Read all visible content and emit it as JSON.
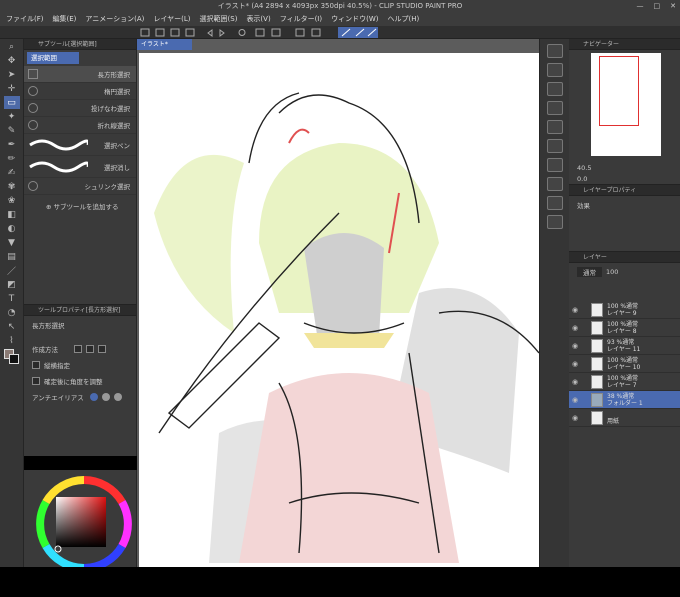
{
  "window": {
    "title": "イラスト* (A4 2894 x 4093px 350dpi 40.5%) - CLIP STUDIO PAINT PRO"
  },
  "menu": [
    "ファイル(F)",
    "編集(E)",
    "アニメーション(A)",
    "レイヤー(L)",
    "選択範囲(S)",
    "表示(V)",
    "フィルター(I)",
    "ウィンドウ(W)",
    "ヘルプ(H)"
  ],
  "subtool": {
    "header": "サブツール[選択範囲]",
    "tab": "選択範囲",
    "items": [
      "長方形選択",
      "楕円選択",
      "投げなわ選択",
      "折れ線選択",
      "選択ペン",
      "選択消し",
      "シュリンク選択"
    ],
    "add_label": "サブツールを追加する"
  },
  "toolprop": {
    "header": "ツールプロパティ[長方形選択]",
    "title": "長方形選択",
    "mode_label": "作成方法",
    "aspect_label": "縦横指定",
    "angle_label": "確定後に角度を調整",
    "aa_label": "アンチエイリアス"
  },
  "canvas": {
    "tab": "イラスト*"
  },
  "navigator": {
    "header": "ナビゲーター",
    "zoom": "40.5",
    "angle": "0.0"
  },
  "layerprop": {
    "header": "レイヤープロパティ",
    "effect_label": "効果"
  },
  "layers": {
    "header": "レイヤー",
    "blend": "通常",
    "opacity": "100",
    "rows": [
      {
        "line1": "100 %通常",
        "line2": "レイヤー 9"
      },
      {
        "line1": "100 %通常",
        "line2": "レイヤー 8"
      },
      {
        "line1": "93 %通常",
        "line2": "レイヤー 11"
      },
      {
        "line1": "100 %通常",
        "line2": "レイヤー 10"
      },
      {
        "line1": "100 %通常",
        "line2": "レイヤー 7"
      },
      {
        "line1": "38 %通常",
        "line2": "フォルダー 1"
      },
      {
        "line1": "",
        "line2": "用紙"
      }
    ]
  },
  "colors": {
    "accent": "#4a6ab0",
    "panel": "#3a3a3a",
    "canvas_bg": "#5c5c5c"
  }
}
